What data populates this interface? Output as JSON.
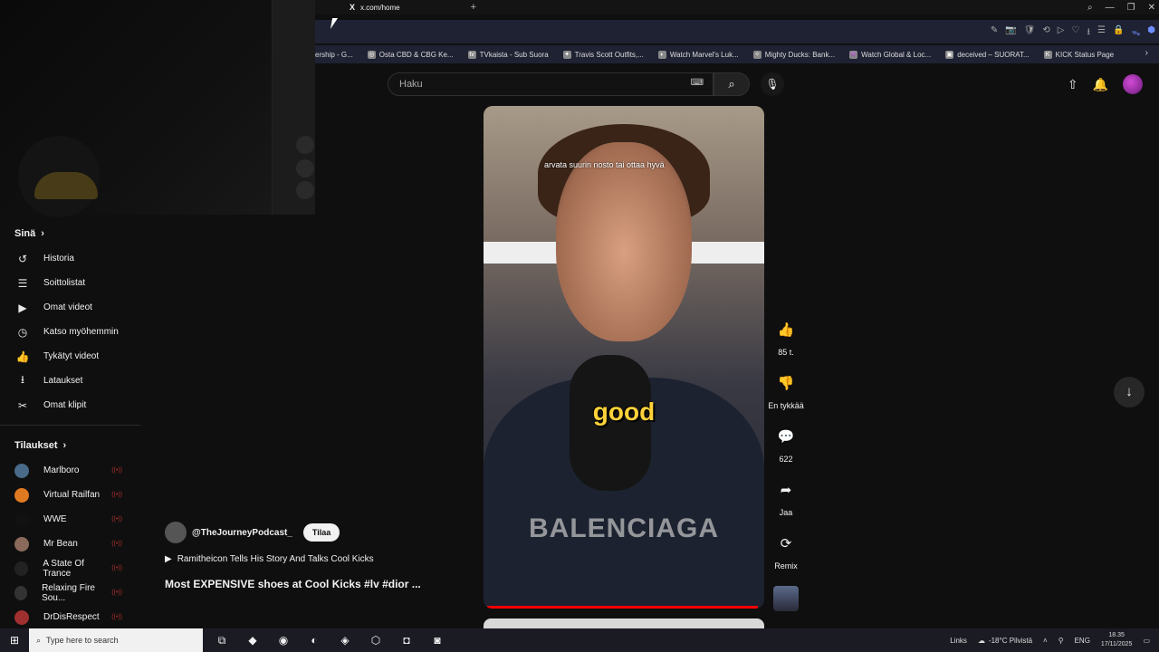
{
  "browser": {
    "tab_title": "x.com/home",
    "tab_logo": "X",
    "new_tab": "+",
    "win_minimize": "—",
    "win_restore": "❐",
    "win_close": "✕",
    "toolbar_icons": [
      "✎",
      "📷",
      "🛡",
      "⟲",
      "▷",
      "♡",
      "⭳",
      "☰",
      "🔒",
      "ᯓ",
      "⬢"
    ],
    "bookmarks": [
      {
        "label": "ership - G...",
        "icon": ""
      },
      {
        "label": "Osta CBD & CBG Ke...",
        "icon": "◎"
      },
      {
        "label": "TVkaista - Sub Suora",
        "icon": "tv"
      },
      {
        "label": "Travis Scott Outfits,...",
        "icon": "✦"
      },
      {
        "label": "Watch Marvel's Luk...",
        "icon": "◐"
      },
      {
        "label": "Mighty Ducks: Bank...",
        "icon": "✧"
      },
      {
        "label": "Watch Global & Loc...",
        "icon": "👾"
      },
      {
        "label": "deceived – SUORAT...",
        "icon": "▣"
      },
      {
        "label": "KICK Status Page",
        "icon": "K"
      }
    ],
    "bookmarks_more": "›"
  },
  "header": {
    "search_placeholder": "Haku",
    "keyboard_icon": "⌨",
    "search_icon": "⌕",
    "mic_icon": "🎙",
    "upload_icon": "⇧",
    "bell_icon": "🔔"
  },
  "sidebar": {
    "you_title": "Sinä",
    "chevron": "›",
    "you_items": [
      {
        "label": "Historia",
        "icon": "↺"
      },
      {
        "label": "Soittolistat",
        "icon": "☰"
      },
      {
        "label": "Omat videot",
        "icon": "▶"
      },
      {
        "label": "Katso myöhemmin",
        "icon": "◷"
      },
      {
        "label": "Tykätyt videot",
        "icon": "👍"
      },
      {
        "label": "Lataukset",
        "icon": "⭳"
      },
      {
        "label": "Omat klipit",
        "icon": "✂"
      }
    ],
    "subs_title": "Tilaukset",
    "live_mark": "((•))",
    "subscriptions": [
      {
        "label": "Marlboro",
        "color": "#4a6a8a"
      },
      {
        "label": "Virtual Railfan",
        "color": "#e07a20"
      },
      {
        "label": "WWE",
        "color": "#111111"
      },
      {
        "label": "Mr Bean",
        "color": "#8a6a5a"
      },
      {
        "label": "A State Of Trance",
        "color": "#222222"
      },
      {
        "label": "Relaxing Fire Sou...",
        "color": "#333333"
      },
      {
        "label": "DrDisRespect",
        "color": "#a03030"
      }
    ]
  },
  "short": {
    "caption_top": "arvata suurin nosto tai ottaa hyvä",
    "caption_big": "good",
    "brand_text": "BALENCIAGA",
    "channel": "@TheJourneyPodcast_",
    "subscribe_label": "Tilaa",
    "playlist_icon": "▶",
    "playlist": "Ramitheicon Tells His Story And Talks Cool Kicks",
    "title": "Most EXPENSIVE shoes at Cool Kicks #lv #dior ...",
    "progress": 0.99
  },
  "actions": {
    "like_icon": "👍",
    "like_count": "85 t.",
    "dislike_icon": "👎",
    "dislike_label": "En tykkää",
    "comment_icon": "💬",
    "comment_count": "622",
    "share_icon": "➦",
    "share_label": "Jaa",
    "remix_icon": "⟳",
    "remix_label": "Remix",
    "next_icon": "↓"
  },
  "taskbar": {
    "start_icon": "⊞",
    "search_placeholder": "Type here to search",
    "search_icon": "⌕",
    "apps": [
      "⧉",
      "◆",
      "◉",
      "◐",
      "◈",
      "⬡",
      "◘",
      "◙"
    ],
    "links": "Links",
    "weather": "-18°C Pilvistä",
    "tray_up": "˄",
    "lang": "ENG",
    "time": "18.35",
    "date": "17/11/2025",
    "notif_icon": "▭"
  }
}
